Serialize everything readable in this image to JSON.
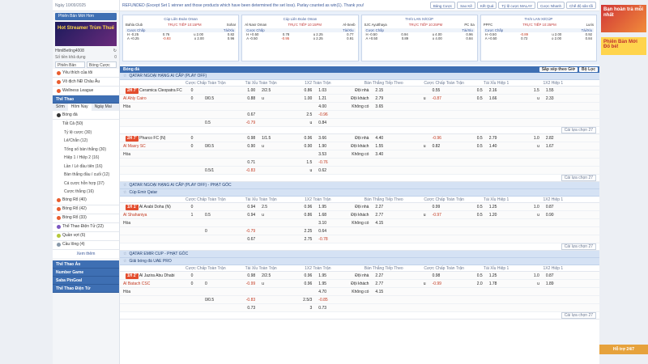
{
  "topbar": {
    "datetime": "Ngày 10/09/2025",
    "marquee": "REFUNDED (Except Set 1 winner and those products which have been determined the set loss). Parlay counted as win(1). Thank you!",
    "buttons": [
      "Bảng Cược",
      "Sao Kê",
      "Kết Quả",
      "Tỷ lệ cược MALAY",
      "Cược Nhanh",
      "Chế độ sân tối"
    ]
  },
  "sidebar": {
    "top_button": "Phiên Bản Mới Hơn",
    "banner": "Hot Streamer Trùm Thuế",
    "user": "HtmlBetIng4008",
    "balance_label": "Số tiền khả dụng",
    "balance_value": "0",
    "selects": [
      "Phiên Bản",
      "Bóng Cược"
    ],
    "quick": [
      "Yêu thích của tôi",
      "Vô địch NĐ Châu Âu",
      "Wellness League"
    ],
    "sports_head": "Thể Thao",
    "tabs": [
      "Sớm",
      "Hôm Nay",
      "Ngày Mai"
    ],
    "football": "Bóng đá",
    "football_items": [
      "Tất Cả (50)",
      "Tỷ lệ cược (30)",
      "Lẻ/Chẵn (12)",
      "Tổng số bàn thắng (30)",
      "Hiệp 1 / Hiệp 2 (16)",
      "Lần / Lẻ đầu tiên (16)",
      "Bàn thắng đầu / cuối (12)",
      "Cá cược hỗn hợp (37)",
      "Cược thắng (16)"
    ],
    "other_sports": [
      "Bóng Rổ (40)",
      "Bóng Rổ (42)",
      "Bóng Rổ (33)",
      "Thể Thao Điện Tử (22)",
      "Quần vợt (6)",
      "Cầu lông (4)"
    ],
    "see_more": "Xem thêm",
    "bottom_heads": [
      "Thể Thao Ảo",
      "Number Game",
      "Saba PinGoal",
      "Thể Thao Điện Tử"
    ]
  },
  "cards": [
    {
      "league": "Cúp Liên Đoàn Oman",
      "home": "Bahla Club",
      "away": "Sohar",
      "status": "TRỰC TIẾP",
      "time": "10:15PM",
      "hdr_a": "Cược Chấp",
      "hdr_b": "Tài/Xỉu",
      "h": [
        "H -0.25",
        "0.76",
        "u 2.00",
        "0.82"
      ],
      "a": [
        "A +0.25",
        "-0.93",
        "o 2.00",
        "0.96"
      ]
    },
    {
      "league": "Cúp Liên Đoàn Oman",
      "home": "Al Nasr Oman",
      "away": "Al-Seeb",
      "status": "TRỰC TIẾP",
      "time": "10:15PM",
      "hdr_a": "Cược Chấp",
      "hdr_b": "Tài/Xỉu",
      "h": [
        "H +0.50",
        "0.78",
        "u 2.25",
        "0.77"
      ],
      "a": [
        "A -0.50",
        "-0.95",
        "o 2.25",
        "0.91"
      ]
    },
    {
      "league": "THÁI LAN XI/CÚP",
      "home": "SJC Ayutthaya",
      "away": "PC Sa",
      "status": "TRỰC TIẾP",
      "time": "10:25PM",
      "hdr_a": "Cược Chấp",
      "hdr_b": "Tài/Xỉu",
      "h": [
        "H -0.50",
        "0.94",
        "u 4.00",
        "0.96"
      ],
      "a": [
        "A +0.50",
        "0.89",
        "o 4.00",
        "0.84"
      ]
    },
    {
      "league": "THÁI LAN XI/CÚP",
      "home": "PPFC",
      "away": "Luris",
      "status": "TRỰC TIẾP",
      "time": "10:25PM",
      "hdr_a": "Cược Chấp",
      "hdr_b": "Tài/Xỉu",
      "h": [
        "H -0.50",
        "-0.89",
        "u 2.00",
        "0.92"
      ],
      "a": [
        "A +0.50",
        "0.72",
        "o 2.00",
        "0.84"
      ]
    }
  ],
  "main": {
    "sport": "Bóng đá",
    "opts": [
      "Sắp xếp theo Giờ",
      "Bộ Lọc"
    ],
    "col_heads": [
      "Cược Chấp Toàn Trận",
      "Tài Xỉu Toàn Trận",
      "1X2 Toàn Trận",
      "Bàn Thắng Tiếp Theo",
      "Cược Chấp Toàn Trận",
      "Tài Xỉu Hiệp 1",
      "1X2 Hiệp 1"
    ],
    "leagues": [
      {
        "name": "QATAR NGOẠI HẠNG AI CẤP (PLAY OFF)",
        "matches": [
          {
            "time": "2H 7'",
            "home": "Ceramica Cleopatra FC (N)",
            "away": "Al Ahly Cairo",
            "draw": "Hòa",
            "h_score": "0",
            "a_score": "0",
            "rows": [
              [
                "",
                "1.00",
                "2/2.5",
                "0.86",
                "1.03",
                "Đội nhà",
                "2.15",
                "",
                "0.55",
                "0.5",
                "2.16",
                "1.5",
                "1.55"
              ],
              [
                "0/0.5",
                "0.88",
                "u",
                "1.00",
                "1.21",
                "Đội khách",
                "2.79",
                "u",
                "-0.87",
                "0.5",
                "1.66",
                "u",
                "2.33"
              ],
              [
                "",
                "",
                "",
                "",
                "4.00",
                "Không có",
                "3.65",
                "",
                "",
                "",
                "",
                "",
                ""
              ],
              [
                "",
                "0.67",
                "",
                "2.5",
                "-0.96",
                "",
                "",
                "",
                "",
                "",
                "",
                "",
                ""
              ],
              [
                "0.5",
                "-0.79",
                "",
                "u",
                "0.84",
                "",
                "",
                "",
                "",
                "",
                "",
                "",
                ""
              ]
            ]
          },
          {
            "time": "2H 7'",
            "home": "Pharco FC (N)",
            "away": "Al Masry SC",
            "draw": "Hòa",
            "h_score": "0",
            "a_score": "0",
            "rows": [
              [
                "",
                "0.98",
                "1/1.5",
                "0.96",
                "3.66",
                "Đội nhà",
                "4.40",
                "",
                "-0.96",
                "0.5",
                "2.79",
                "1.0",
                "2.82"
              ],
              [
                "0/0.5",
                "0.90",
                "u",
                "0.90",
                "1.90",
                "Đội khách",
                "1.55",
                "u",
                "0.82",
                "0.5",
                "1.40",
                "u",
                "1.67"
              ],
              [
                "",
                "",
                "",
                "",
                "3.53",
                "Không có",
                "3.40",
                "",
                "",
                "",
                "",
                "",
                ""
              ],
              [
                "",
                "0.71",
                "",
                "1.5",
                "-0.76",
                "",
                "",
                "",
                "",
                "",
                "",
                "",
                ""
              ],
              [
                "0.5/1",
                "-0.83",
                "",
                "u",
                "0.62",
                "",
                "",
                "",
                "",
                "",
                "",
                "",
                ""
              ]
            ]
          }
        ]
      },
      {
        "name": "QATAR NGOẠI HẠNG AI CẤP (PLAY OFF) - PHẠT GÓC"
      },
      {
        "name": "Cúp Emir Qatar",
        "matches": [
          {
            "time": "1H 1'",
            "home": "Al Arabi Doha (N)",
            "away": "Al Shahaniya",
            "draw": "Hòa",
            "h_score": "0",
            "a_score": "1",
            "rows": [
              [
                "",
                "0.94",
                "2.5",
                "0.96",
                "1.95",
                "Đội nhà",
                "2.27",
                "",
                "0.99",
                "0.5",
                "1.25",
                "1.0",
                "0.87"
              ],
              [
                "0.5",
                "0.94",
                "u",
                "0.86",
                "1.68",
                "Đội khách",
                "2.77",
                "u",
                "-0.97",
                "0.5",
                "1.20",
                "u",
                "0.90"
              ],
              [
                "",
                "",
                "",
                "",
                "3.10",
                "Không có",
                "4.15",
                "",
                "",
                "",
                "",
                "",
                ""
              ],
              [
                "0",
                "-0.79",
                "",
                "2.25",
                "0.64",
                "",
                "",
                "",
                "",
                "",
                "",
                "",
                ""
              ],
              [
                "",
                "0.67",
                "",
                "2.75",
                "-0.78",
                "",
                "",
                "",
                "",
                "",
                "",
                "",
                ""
              ]
            ]
          }
        ]
      },
      {
        "name": "QATAR EMIR CUP - PHẠT GÓC"
      },
      {
        "name": "Giải bóng đá UAE PRO",
        "matches": [
          {
            "time": "1H 2'",
            "home": "Al Jazira Abu Dhabi",
            "away": "Al Batach CSC",
            "draw": "Hòa",
            "h_score": "0",
            "a_score": "0",
            "rows": [
              [
                "",
                "0.98",
                "2/2.5",
                "0.96",
                "1.95",
                "Đội nhà",
                "2.27",
                "",
                "0.98",
                "0.5",
                "1.25",
                "1.0",
                "0.87"
              ],
              [
                "0",
                "-0.99",
                "u",
                "0.96",
                "1.95",
                "Đội khách",
                "2.77",
                "u",
                "-0.99",
                "2.0",
                "1.78",
                "u",
                "1.89"
              ],
              [
                "",
                "",
                "",
                "",
                "4.70",
                "Không có",
                "4.15",
                "",
                "",
                "",
                "",
                "",
                ""
              ],
              [
                "0/0.5",
                "-0.83",
                "",
                "2.5/3",
                "-0.85",
                "",
                "",
                "",
                "",
                "",
                "",
                "",
                ""
              ],
              [
                "",
                "0.73",
                "",
                "3",
                "0.73",
                "",
                "",
                "",
                "",
                "",
                "",
                "",
                ""
              ]
            ]
          }
        ]
      }
    ],
    "more_label": "Cài lựa chọn",
    "more_count": "27"
  },
  "promo": {
    "banner1": "Bạn hoàn trả mỗi nhất",
    "banner2": "Phiên Bản Mới Đổ bé!",
    "chat": "Hỗ trợ 24/7"
  }
}
